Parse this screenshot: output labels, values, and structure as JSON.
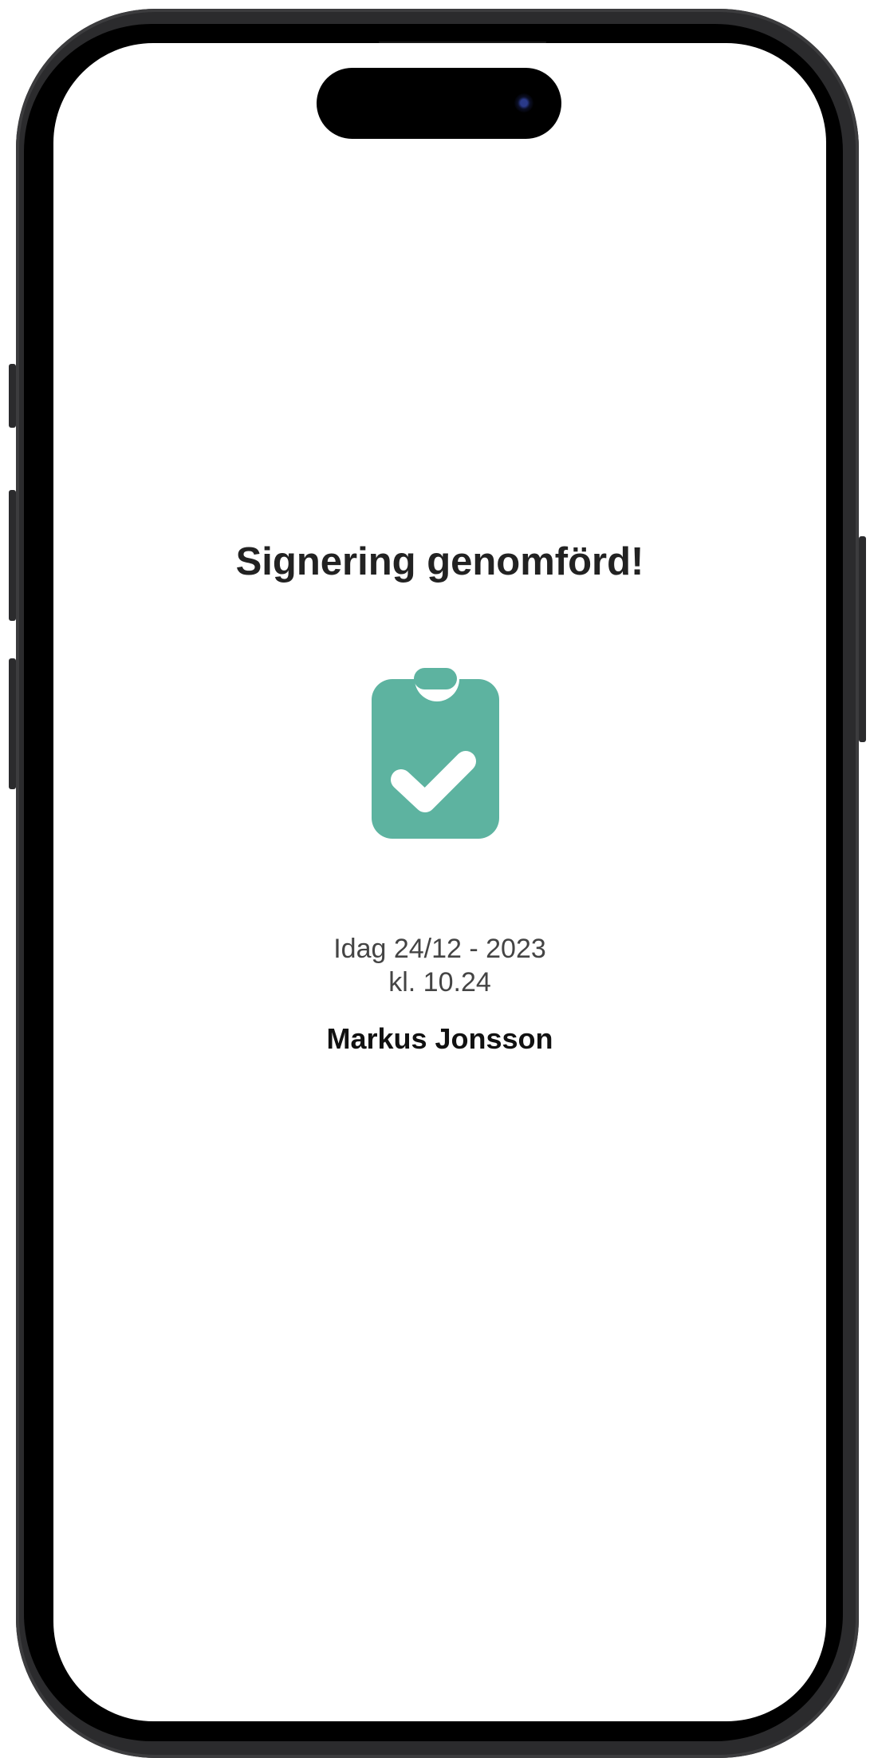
{
  "screen": {
    "title": "Signering genomförd!",
    "status_icon": "clipboard-check-icon",
    "date_line": "Idag 24/12 - 2023",
    "time_line": "kl. 10.24",
    "signer_name": "Markus Jonsson"
  },
  "colors": {
    "accent": "#5DB3A0",
    "title_text": "#222222",
    "secondary_text": "#444444"
  }
}
